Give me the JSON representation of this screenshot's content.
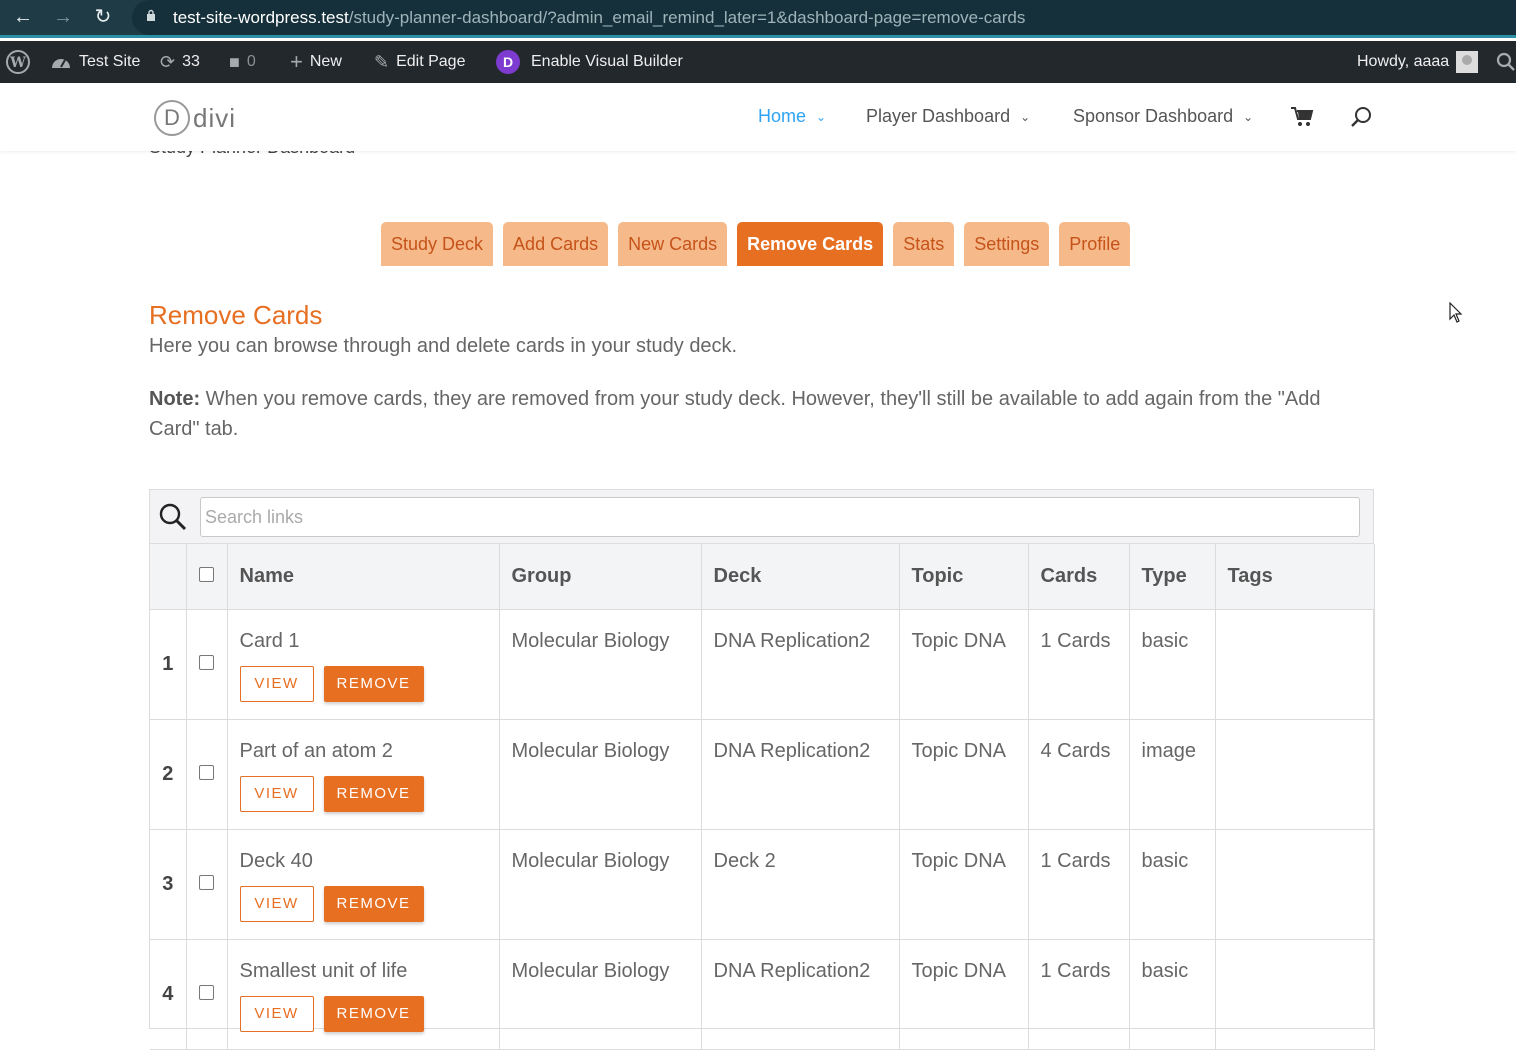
{
  "browser": {
    "url_host": "test-site-wordpress.test",
    "url_path": "/study-planner-dashboard/?admin_email_remind_later=1&dashboard-page=remove-cards"
  },
  "admin_bar": {
    "site_name": "Test Site",
    "updates_count": "33",
    "comments_count": "0",
    "new_label": "New",
    "edit_page_label": "Edit Page",
    "visual_builder_label": "Enable Visual Builder",
    "divi_letter": "D",
    "howdy": "Howdy, aaaa"
  },
  "header": {
    "logo_letter": "D",
    "logo_text": "divi",
    "menu": [
      {
        "label": "Home"
      },
      {
        "label": "Player Dashboard"
      },
      {
        "label": "Sponsor Dashboard"
      }
    ]
  },
  "page": {
    "partial_title": "Study Planner Dashboard",
    "tabs": [
      {
        "label": "Study Deck"
      },
      {
        "label": "Add Cards"
      },
      {
        "label": "New Cards"
      },
      {
        "label": "Remove Cards"
      },
      {
        "label": "Stats"
      },
      {
        "label": "Settings"
      },
      {
        "label": "Profile"
      }
    ],
    "active_tab": "Remove Cards",
    "heading": "Remove Cards",
    "intro": "Here you can browse through and delete cards in your study deck.",
    "note_label": "Note:",
    "note_text": " When you remove cards, they are removed from your study deck. However, they'll still be available to add again from the \"Add Card\" tab."
  },
  "table": {
    "search_placeholder": "Search links",
    "columns": [
      "Name",
      "Group",
      "Deck",
      "Topic",
      "Cards",
      "Type",
      "Tags"
    ],
    "view_label": "VIEW",
    "remove_label": "REMOVE",
    "rows": [
      {
        "num": "1",
        "name": "Card 1",
        "group": "Molecular Biology",
        "deck": "DNA Replication2",
        "topic": "Topic DNA",
        "cards": "1 Cards",
        "type": "basic",
        "tags": ""
      },
      {
        "num": "2",
        "name": "Part of an atom 2",
        "group": "Molecular Biology",
        "deck": "DNA Replication2",
        "topic": "Topic DNA",
        "cards": "4 Cards",
        "type": "image",
        "tags": ""
      },
      {
        "num": "3",
        "name": "Deck 40",
        "group": "Molecular Biology",
        "deck": "Deck 2",
        "topic": "Topic DNA",
        "cards": "1 Cards",
        "type": "basic",
        "tags": ""
      },
      {
        "num": "4",
        "name": "Smallest unit of life",
        "group": "Molecular Biology",
        "deck": "DNA Replication2",
        "topic": "Topic DNA",
        "cards": "1 Cards",
        "type": "basic",
        "tags": ""
      }
    ]
  },
  "colors": {
    "accent": "#e76f22",
    "tab_inactive": "#f6b98a",
    "link_blue": "#2ea3f2",
    "admin_bar": "#23282d"
  }
}
